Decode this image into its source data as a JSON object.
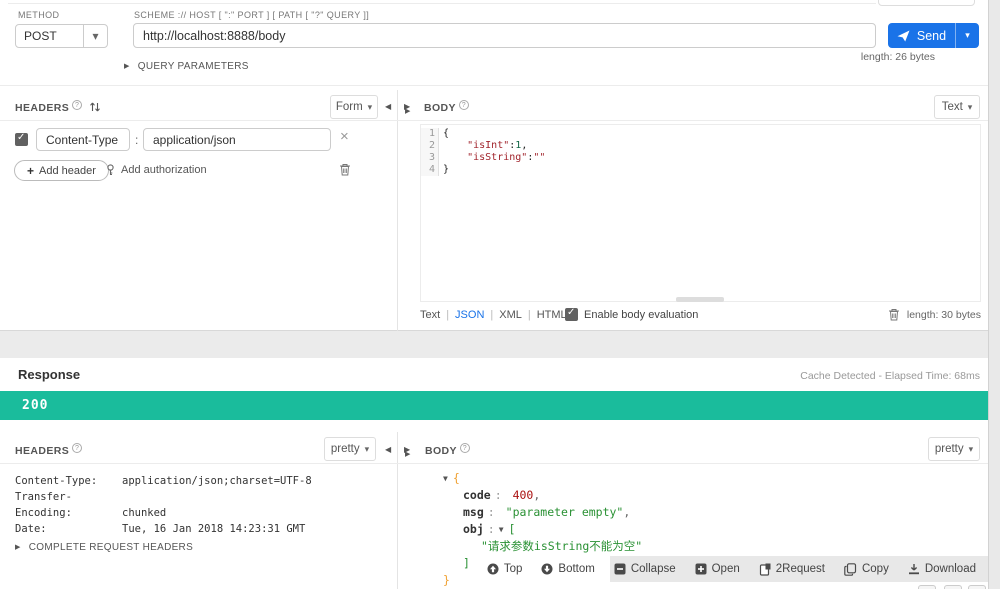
{
  "request": {
    "method": {
      "label": "METHOD",
      "value": "POST"
    },
    "url": {
      "label": "SCHEME :// HOST [ \":\" PORT ] [ PATH [ \"?\" QUERY ]]",
      "value": "http://localhost:8888/body",
      "length": "length: 26 bytes"
    },
    "send_label": "Send",
    "query_parameters_label": "QUERY PARAMETERS",
    "headers": {
      "title": "HEADERS",
      "format": "Form",
      "row": {
        "name": "Content-Type",
        "separator": ":",
        "value": "application/json"
      },
      "add_header": "Add header",
      "add_header_plus": "+",
      "add_authorization": "Add authorization"
    },
    "body": {
      "title": "BODY",
      "format": "Text",
      "lines": [
        {
          "n": "1",
          "plain": "{"
        },
        {
          "n": "2",
          "indent": "    ",
          "str": "\"isInt\"",
          "colon": ":",
          "num": "1",
          "comma": ","
        },
        {
          "n": "3",
          "indent": "    ",
          "str": "\"isString\"",
          "colon": ":",
          "str2": "\"\""
        },
        {
          "n": "4",
          "plain": "}"
        }
      ],
      "modes": [
        "Text",
        "JSON",
        "XML",
        "HTML"
      ],
      "evaluation_label": "Enable body evaluation",
      "length": "length: 30 bytes"
    }
  },
  "response": {
    "title": "Response",
    "meta": "Cache Detected - Elapsed Time: 68ms",
    "status": "200",
    "headers": {
      "title": "HEADERS",
      "format": "pretty",
      "rows": [
        {
          "key": "Content-Type:",
          "value": "application/json;charset=UTF-8"
        },
        {
          "key": "Transfer-Encoding:",
          "value": "chunked"
        },
        {
          "key": "Date:",
          "value": "Tue, 16 Jan 2018 14:23:31 GMT"
        }
      ],
      "complete_request_headers": "COMPLETE REQUEST HEADERS"
    },
    "body": {
      "title": "BODY",
      "format": "pretty",
      "tree": {
        "brace_open": "{",
        "key_code": "code",
        "colon": ":",
        "val_code": "400",
        "comma": ",",
        "key_msg": "msg",
        "val_msg": "\"parameter empty\"",
        "key_obj": "obj",
        "bracket_open": "[",
        "item": "\"请求参数isString不能为空\"",
        "bracket_close": "]",
        "brace_close": "}"
      },
      "toolbar": [
        {
          "label": "Top"
        },
        {
          "label": "Bottom"
        },
        {
          "label": "Collapse"
        },
        {
          "label": "Open"
        },
        {
          "label": "2Request"
        },
        {
          "label": "Copy"
        },
        {
          "label": "Download"
        }
      ]
    }
  },
  "colors": {
    "accent_blue": "#1a73e8",
    "status_green": "#1abc9c",
    "code_string_red": "#a1242c",
    "code_number_green": "#116644",
    "json_string_green": "#2a9134",
    "json_brace_orange": "#f0a132",
    "json_number_red": "#aa1111"
  }
}
